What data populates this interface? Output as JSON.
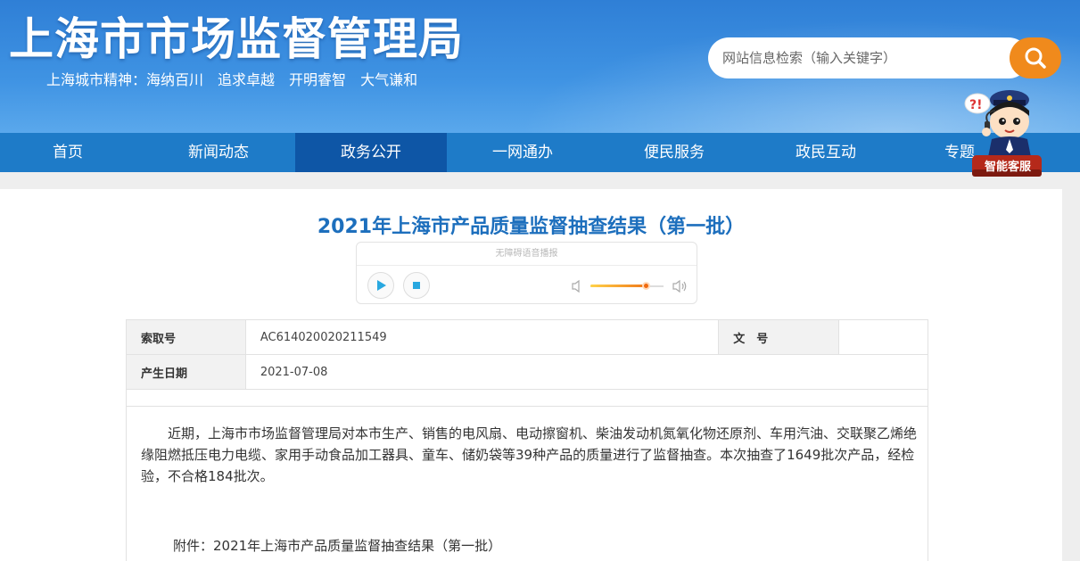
{
  "header": {
    "site_title": "上海市市场监督管理局",
    "slogan_prefix": "上海城市精神：",
    "slogan_items": [
      "海纳百川",
      "追求卓越",
      "开明睿智",
      "大气谦和"
    ]
  },
  "search": {
    "placeholder": "网站信息检索（输入关键字）",
    "button_icon": "search-icon"
  },
  "nav": {
    "items": [
      {
        "label": "首页"
      },
      {
        "label": "新闻动态"
      },
      {
        "label": "政务公开",
        "active": true
      },
      {
        "label": "一网通办"
      },
      {
        "label": "便民服务"
      },
      {
        "label": "政民互动"
      },
      {
        "label": "专题"
      }
    ]
  },
  "assistant": {
    "label": "智能客服",
    "bubble": "?!"
  },
  "article": {
    "title": "2021年上海市产品质量监督抽查结果（第一批）",
    "player": {
      "label": "无障碍语音播报",
      "volume": 0.75
    },
    "meta": {
      "index_label": "索取号",
      "index_value": "AC614020020211549",
      "doc_label": "文　号",
      "doc_value": "",
      "date_label": "产生日期",
      "date_value": "2021-07-08"
    },
    "paragraph": "近期，上海市市场监督管理局对本市生产、销售的电风扇、电动擦窗机、柴油发动机氮氧化物还原剂、车用汽油、交联聚乙烯绝缘阻燃抵压电力电缆、家用手动食品加工器具、童车、储奶袋等39种产品的质量进行了监督抽查。本次抽查了1649批次产品，经检验，不合格184批次。",
    "attachment": "附件：2021年上海市产品质量监督抽查结果（第一批）"
  },
  "colors": {
    "header": "#2f7fd6",
    "nav": "#1e7bc8",
    "nav_active": "#0e56a6",
    "title": "#1d6fbd",
    "search_button": "#f08a1c"
  }
}
